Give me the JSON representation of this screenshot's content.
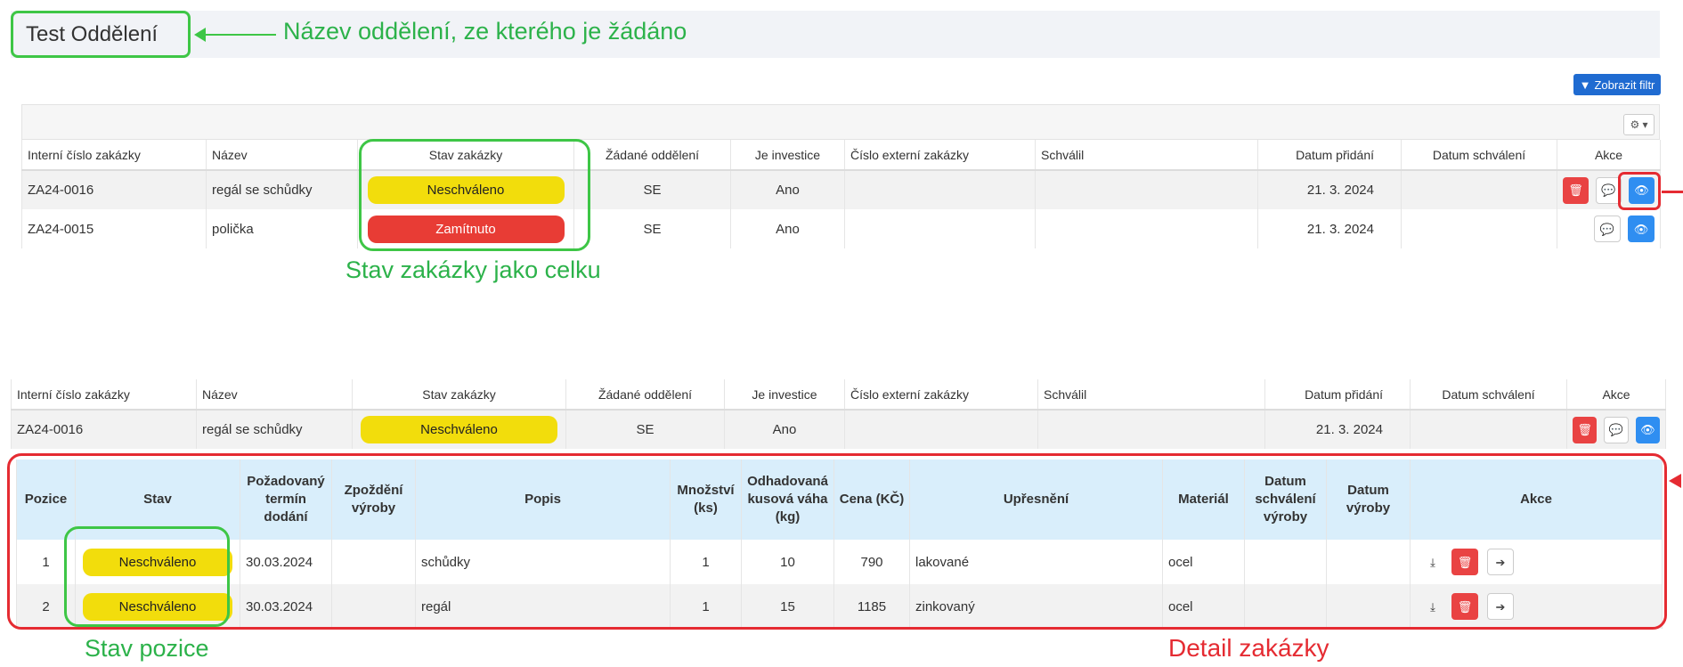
{
  "department": {
    "name": "Test Oddělení",
    "annotation": "Název oddělení, ze kterého je žádáno"
  },
  "filter_button": {
    "label": "Zobrazit filtr",
    "icon": "filter-icon"
  },
  "gear_button": {
    "icon": "gear-icon"
  },
  "orders_table": {
    "columns": [
      "Interní číslo zakázky",
      "Název",
      "Stav zakázky",
      "Žádané oddělení",
      "Je investice",
      "Číslo externí zakázky",
      "Schválil",
      "Datum přidání",
      "Datum schválení",
      "Akce"
    ],
    "rows": [
      {
        "number": "ZA24-0016",
        "name": "regál se schůdky",
        "status": "Neschváleno",
        "status_color": "#f2dd0c",
        "department": "SE",
        "investment": "Ano",
        "external": "",
        "approved_by": "",
        "added": "21. 3. 2024",
        "approved": "",
        "actions": [
          "trash-icon",
          "comment-icon",
          "eye-icon"
        ]
      },
      {
        "number": "ZA24-0015",
        "name": "polička",
        "status": "Zamítnuto",
        "status_color": "#e83c35",
        "department": "SE",
        "investment": "Ano",
        "external": "",
        "approved_by": "",
        "added": "21. 3. 2024",
        "approved": "",
        "actions": [
          "comment-icon",
          "eye-icon"
        ]
      }
    ],
    "annotation": "Stav zakázky jako celku"
  },
  "expanded_table": {
    "columns": [
      "Interní číslo zakázky",
      "Název",
      "Stav zakázky",
      "Žádané oddělení",
      "Je investice",
      "Číslo externí zakázky",
      "Schválil",
      "Datum přidání",
      "Datum schválení",
      "Akce"
    ],
    "row": {
      "number": "ZA24-0016",
      "name": "regál se schůdky",
      "status": "Neschváleno",
      "department": "SE",
      "investment": "Ano",
      "external": "",
      "approved_by": "",
      "added": "21. 3. 2024",
      "approved": "",
      "actions": [
        "trash-icon",
        "comment-icon",
        "eye-icon"
      ]
    }
  },
  "detail": {
    "columns": [
      "Pozice",
      "Stav",
      "Požadovaný termín dodání",
      "Zpoždění výroby",
      "Popis",
      "Množství (ks)",
      "Odhadovaná kusová váha (kg)",
      "Cena (KČ)",
      "Upřesnění",
      "Materiál",
      "Datum schválení výroby",
      "Datum výroby",
      "Akce"
    ],
    "rows": [
      {
        "position": "1",
        "status": "Neschváleno",
        "deadline": "30.03.2024",
        "delay": "",
        "description": "schůdky",
        "quantity": "1",
        "weight": "10",
        "price": "790",
        "note": "lakované",
        "material": "ocel",
        "approved": "",
        "produced": "",
        "actions": [
          "download-icon",
          "trash-icon",
          "arrow-right-icon"
        ]
      },
      {
        "position": "2",
        "status": "Neschváleno",
        "deadline": "30.03.2024",
        "delay": "",
        "description": "regál",
        "quantity": "1",
        "weight": "15",
        "price": "1185",
        "note": "zinkovaný",
        "material": "ocel",
        "approved": "",
        "produced": "",
        "actions": [
          "download-icon",
          "trash-icon",
          "arrow-right-icon"
        ]
      }
    ],
    "position_status_annotation": "Stav pozice",
    "detail_annotation": "Detail zakázky"
  },
  "colors": {
    "green_annotation": "#3ec646",
    "red_annotation": "#e52b32",
    "pill_yellow": "#f2dd0c",
    "pill_red": "#e83c35",
    "primary_blue": "#2f8ef1",
    "detail_header_bg": "#d9eefb"
  }
}
